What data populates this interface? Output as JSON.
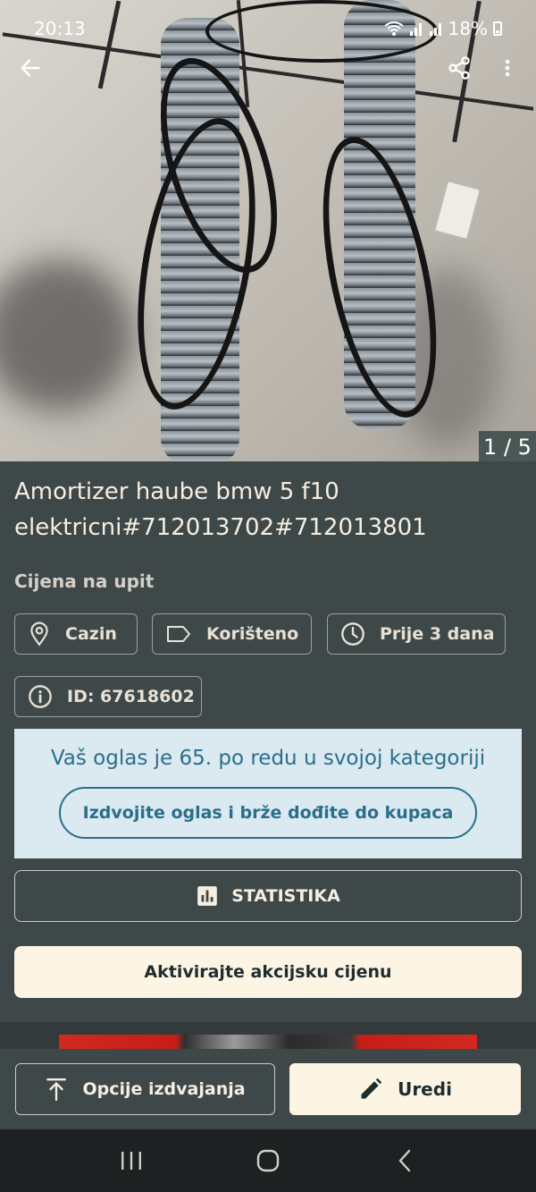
{
  "status_bar": {
    "time": "20:13",
    "battery": "18%",
    "icons": [
      "wifi-icon",
      "signal-icon",
      "signal-icon",
      "battery-icon"
    ]
  },
  "top_nav": {
    "back_icon": "arrow-left-icon",
    "share_icon": "share-icon",
    "more_icon": "more-vertical-icon"
  },
  "gallery": {
    "counter": "1 / 5"
  },
  "listing": {
    "title": "Amortizer haube bmw 5 f10 elektricni#712013702#712013801",
    "price": "Cijena na upit",
    "chips": {
      "location": "Cazin",
      "condition": "Korišteno",
      "age": "Prije 3 dana",
      "id": "ID: 67618602"
    }
  },
  "promo": {
    "text": "Vaš oglas je 65. po redu u svojoj kategoriji",
    "button": "Izdvojite oglas i brže dođite do kupaca"
  },
  "actions": {
    "statistics": "STATISTIKA",
    "activate_price": "Aktivirajte akcijsku cijenu"
  },
  "bottom_bar": {
    "options": "Opcije izdvajanja",
    "edit": "Uredi"
  },
  "colors": {
    "background": "#3f4849",
    "accent_text": "#2a6f8a",
    "promo_bg": "#dbe9f1",
    "primary_button": "#fdf5e4"
  }
}
